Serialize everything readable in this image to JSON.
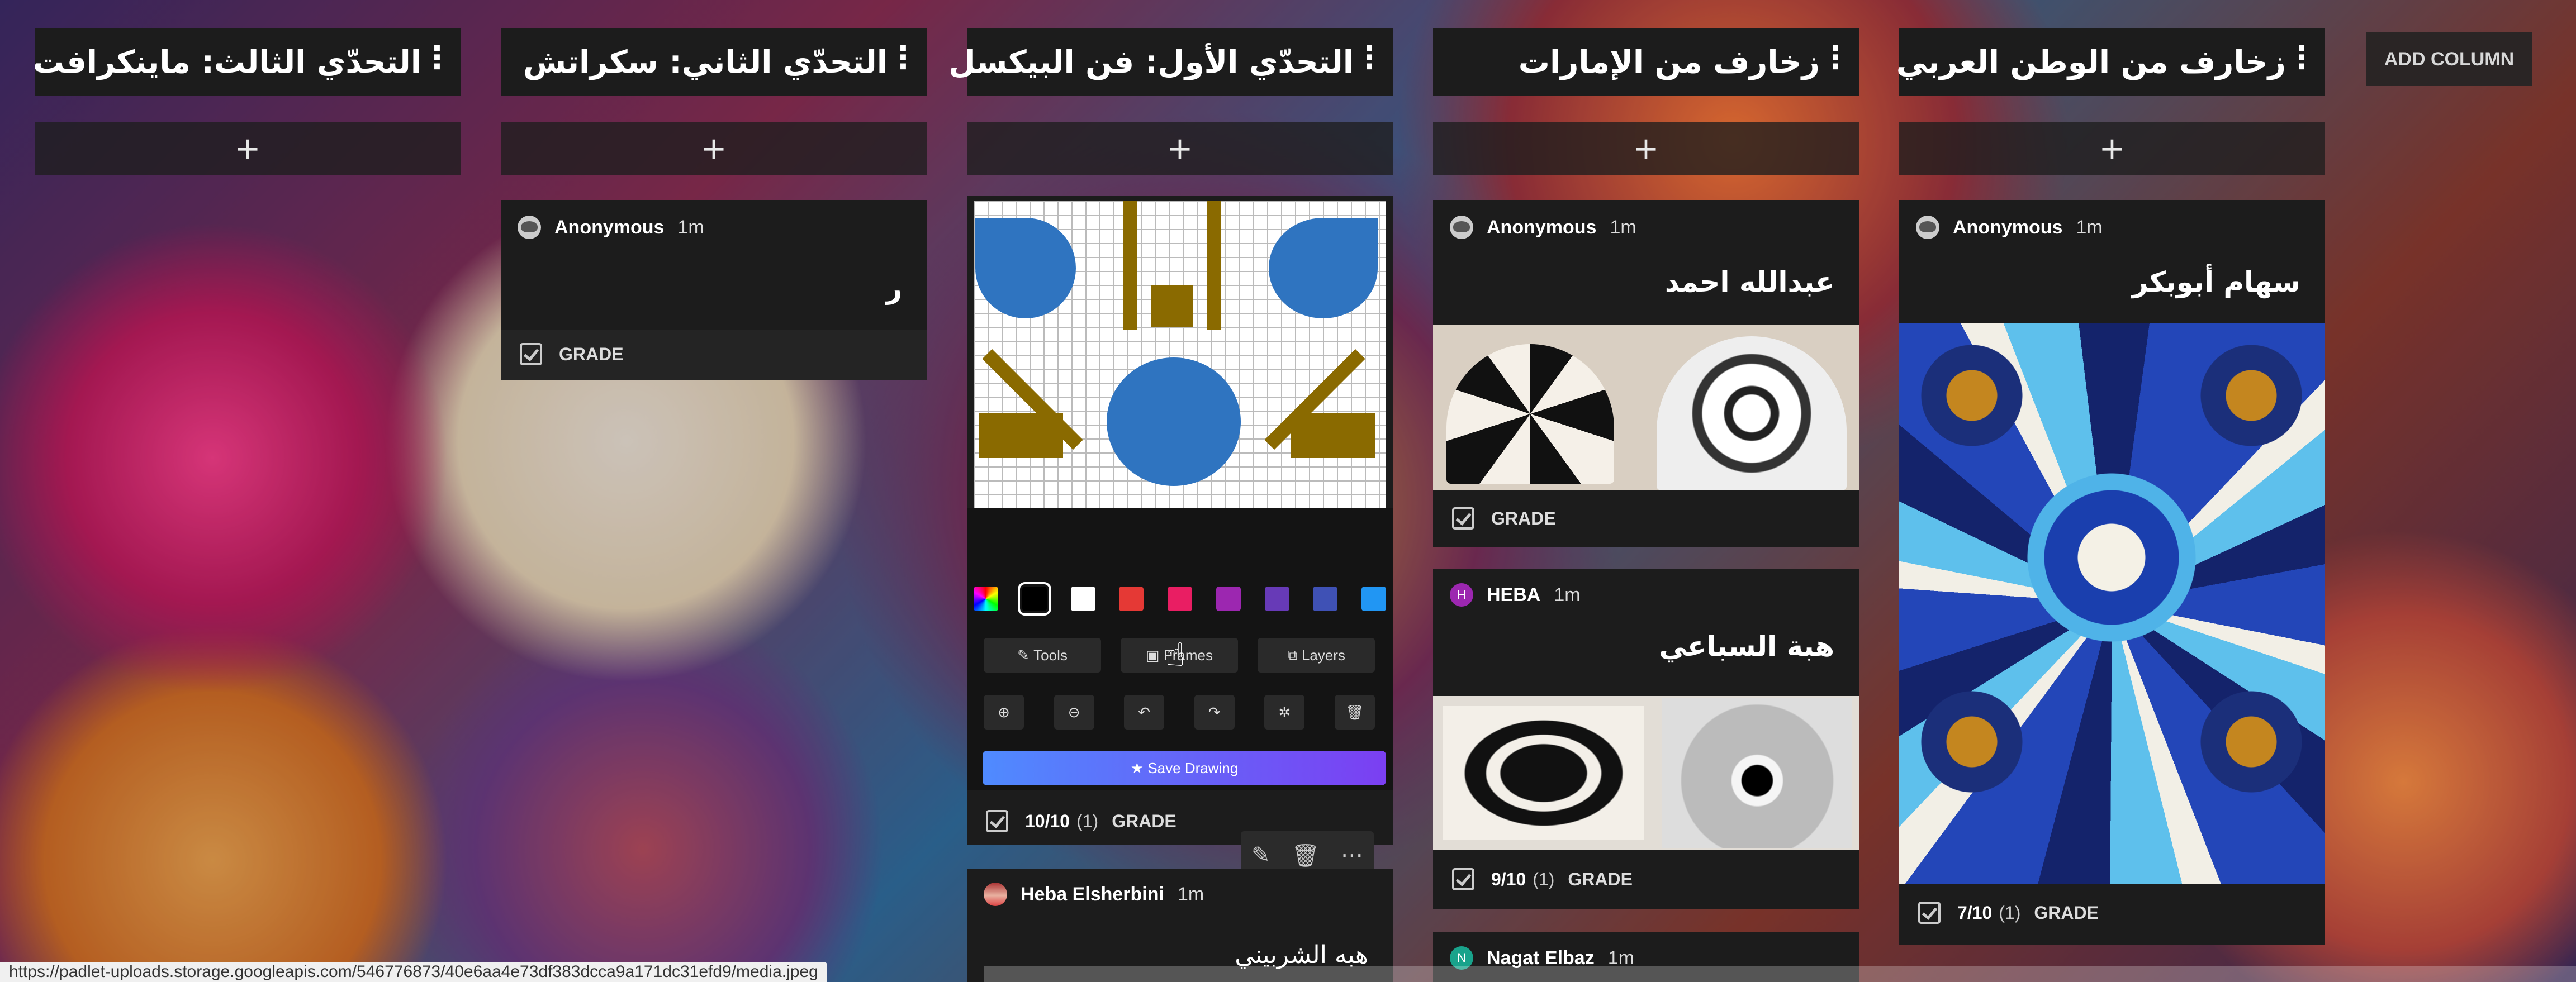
{
  "columns": [
    {
      "title": "التحدّي الثالث: ماينكرافت",
      "add_label": "+"
    },
    {
      "title": "التحدّي الثاني: سكراتش",
      "add_label": "+"
    },
    {
      "title": "التحدّي الأول: فن البيكسل",
      "add_label": "+"
    },
    {
      "title": "زخارف من الإمارات",
      "add_label": "+"
    },
    {
      "title": "زخارف من الوطن العربي",
      "add_label": "+"
    }
  ],
  "add_column_label": "ADD COLUMN",
  "posts": {
    "scratch_post": {
      "author": "Anonymous",
      "time": "1m",
      "body": "ر",
      "grade_label": "GRADE"
    },
    "pixel_post": {
      "score": "10/10",
      "count": "(1)",
      "grade_label": "GRADE",
      "tools": {
        "tools_label": "Tools",
        "frames_label": "Frames",
        "layers_label": "Layers",
        "save_label": "Save Drawing"
      },
      "palette": [
        "#rainbow",
        "#000000",
        "#ffffff",
        "#e53935",
        "#e91e63",
        "#9c27b0",
        "#673ab7",
        "#3f51b5",
        "#2196f3"
      ]
    },
    "heba_elsherbini": {
      "author": "Heba Elsherbini",
      "time": "1m",
      "body": "هبه الشربيني"
    },
    "uae_post_1": {
      "author": "Anonymous",
      "time": "1m",
      "body": "عبدالله احمد",
      "grade_label": "GRADE"
    },
    "uae_post_2": {
      "author": "HEBA",
      "time": "1m",
      "body": "هبة السباعي",
      "score": "9/10",
      "count": "(1)",
      "grade_label": "GRADE"
    },
    "uae_post_3": {
      "author": "Nagat Elbaz",
      "time": "1m"
    },
    "arab_post": {
      "author": "Anonymous",
      "time": "1m",
      "body": "سهام أبوبكر",
      "score": "7/10",
      "count": "(1)",
      "grade_label": "GRADE"
    }
  },
  "status_url": "https://padlet-uploads.storage.googleapis.com/546776873/40e6aa4e73df383dcca9a171dc31efd9/media.jpeg"
}
